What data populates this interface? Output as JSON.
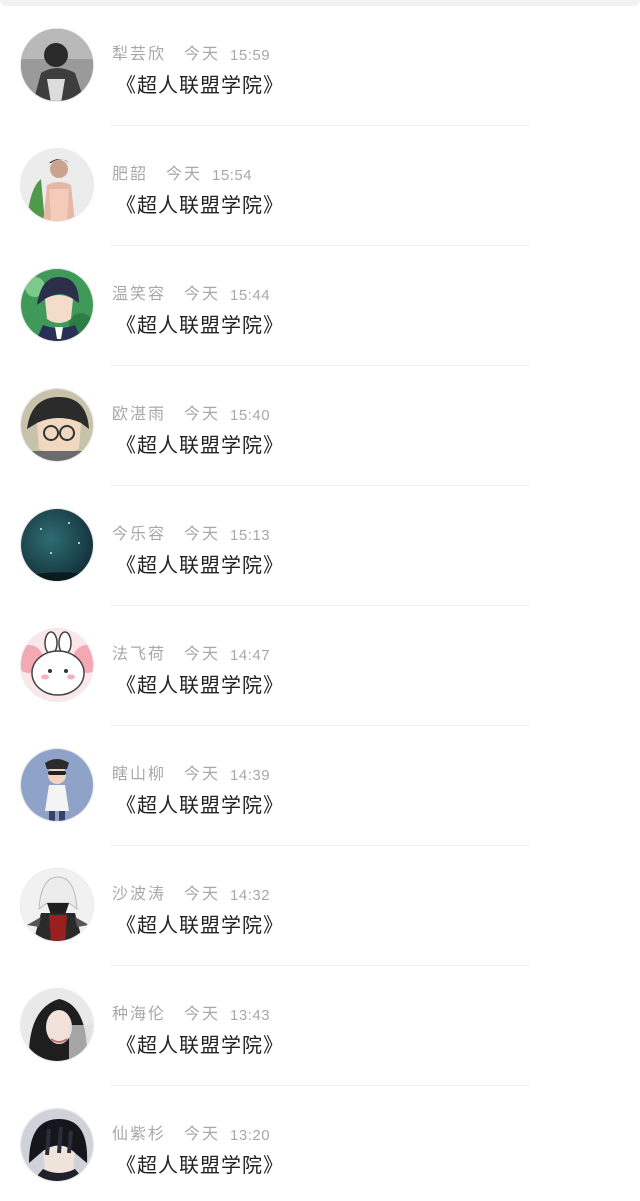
{
  "messages": [
    {
      "avatar": "dark-photo-avatar",
      "name": "犁芸欣",
      "day": "今天",
      "time": "15:59",
      "text": "《超人联盟学院》"
    },
    {
      "avatar": "model-photo-avatar",
      "name": "肥韶",
      "day": "今天",
      "time": "15:54",
      "text": "《超人联盟学院》"
    },
    {
      "avatar": "anime-boy-avatar",
      "name": "温笑容",
      "day": "今天",
      "time": "15:44",
      "text": "《超人联盟学院》"
    },
    {
      "avatar": "anime-glasses-avatar",
      "name": "欧湛雨",
      "day": "今天",
      "time": "15:40",
      "text": "《超人联盟学院》"
    },
    {
      "avatar": "night-sky-avatar",
      "name": "今乐容",
      "day": "今天",
      "time": "15:13",
      "text": "《超人联盟学院》"
    },
    {
      "avatar": "bunny-avatar",
      "name": "法飞荷",
      "day": "今天",
      "time": "14:47",
      "text": "《超人联盟学院》"
    },
    {
      "avatar": "kid-photo-avatar",
      "name": "瞎山柳",
      "day": "今天",
      "time": "14:39",
      "text": "《超人联盟学院》"
    },
    {
      "avatar": "hooded-assassin-avatar",
      "name": "沙波涛",
      "day": "今天",
      "time": "14:32",
      "text": "《超人联盟学院》"
    },
    {
      "avatar": "woman-portrait-avatar",
      "name": "种海伦",
      "day": "今天",
      "time": "13:43",
      "text": "《超人联盟学院》"
    },
    {
      "avatar": "anime-dark-hair-avatar",
      "name": "仙紫杉",
      "day": "今天",
      "time": "13:20",
      "text": "《超人联盟学院》"
    }
  ],
  "colors": {
    "meta_text": "#a8a8a8",
    "message_text": "#222222",
    "divider": "#f0f0f0"
  }
}
